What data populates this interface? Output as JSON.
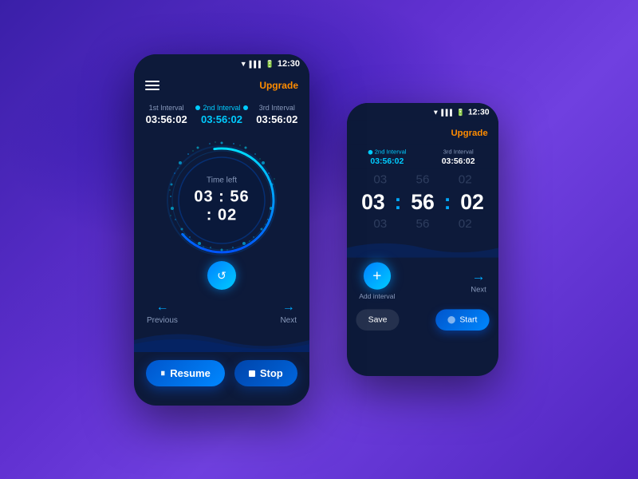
{
  "background": {
    "gradient_start": "#3a1fa8",
    "gradient_end": "#5025c0"
  },
  "phone_main": {
    "status": {
      "time": "12:30",
      "wifi": "▼",
      "signal": "▌▌▌",
      "battery": "▪"
    },
    "header": {
      "menu_icon": "≡",
      "upgrade_label": "Upgrade"
    },
    "intervals": [
      {
        "label": "1st Interval",
        "time": "03:56:02",
        "active": false
      },
      {
        "label": "2nd Interval",
        "time": "03:56:02",
        "active": true
      },
      {
        "label": "3rd Interval",
        "time": "03:56:02",
        "active": false
      }
    ],
    "timer": {
      "label": "Time left",
      "display": "03 : 56 : 02",
      "progress_pct": 65
    },
    "nav": {
      "previous_label": "Previous",
      "next_label": "Next",
      "prev_arrow": "←",
      "next_arrow": "→"
    },
    "actions": {
      "resume_label": "Resume",
      "stop_label": "Stop"
    }
  },
  "phone_secondary": {
    "status": {
      "time": "12:30"
    },
    "header": {
      "upgrade_label": "Upgrade"
    },
    "intervals": [
      {
        "label": "2nd Interval",
        "time": "03:56:02",
        "active": true
      },
      {
        "label": "3rd Interval",
        "time": "03:56:02",
        "active": false
      }
    ],
    "scroll_time": {
      "hours": "03",
      "minutes": "56",
      "seconds": "02"
    },
    "nav": {
      "add_interval_label": "Add interval",
      "next_label": "Next",
      "next_arrow": "→"
    },
    "actions": {
      "save_label": "Save",
      "start_label": "Start"
    }
  }
}
